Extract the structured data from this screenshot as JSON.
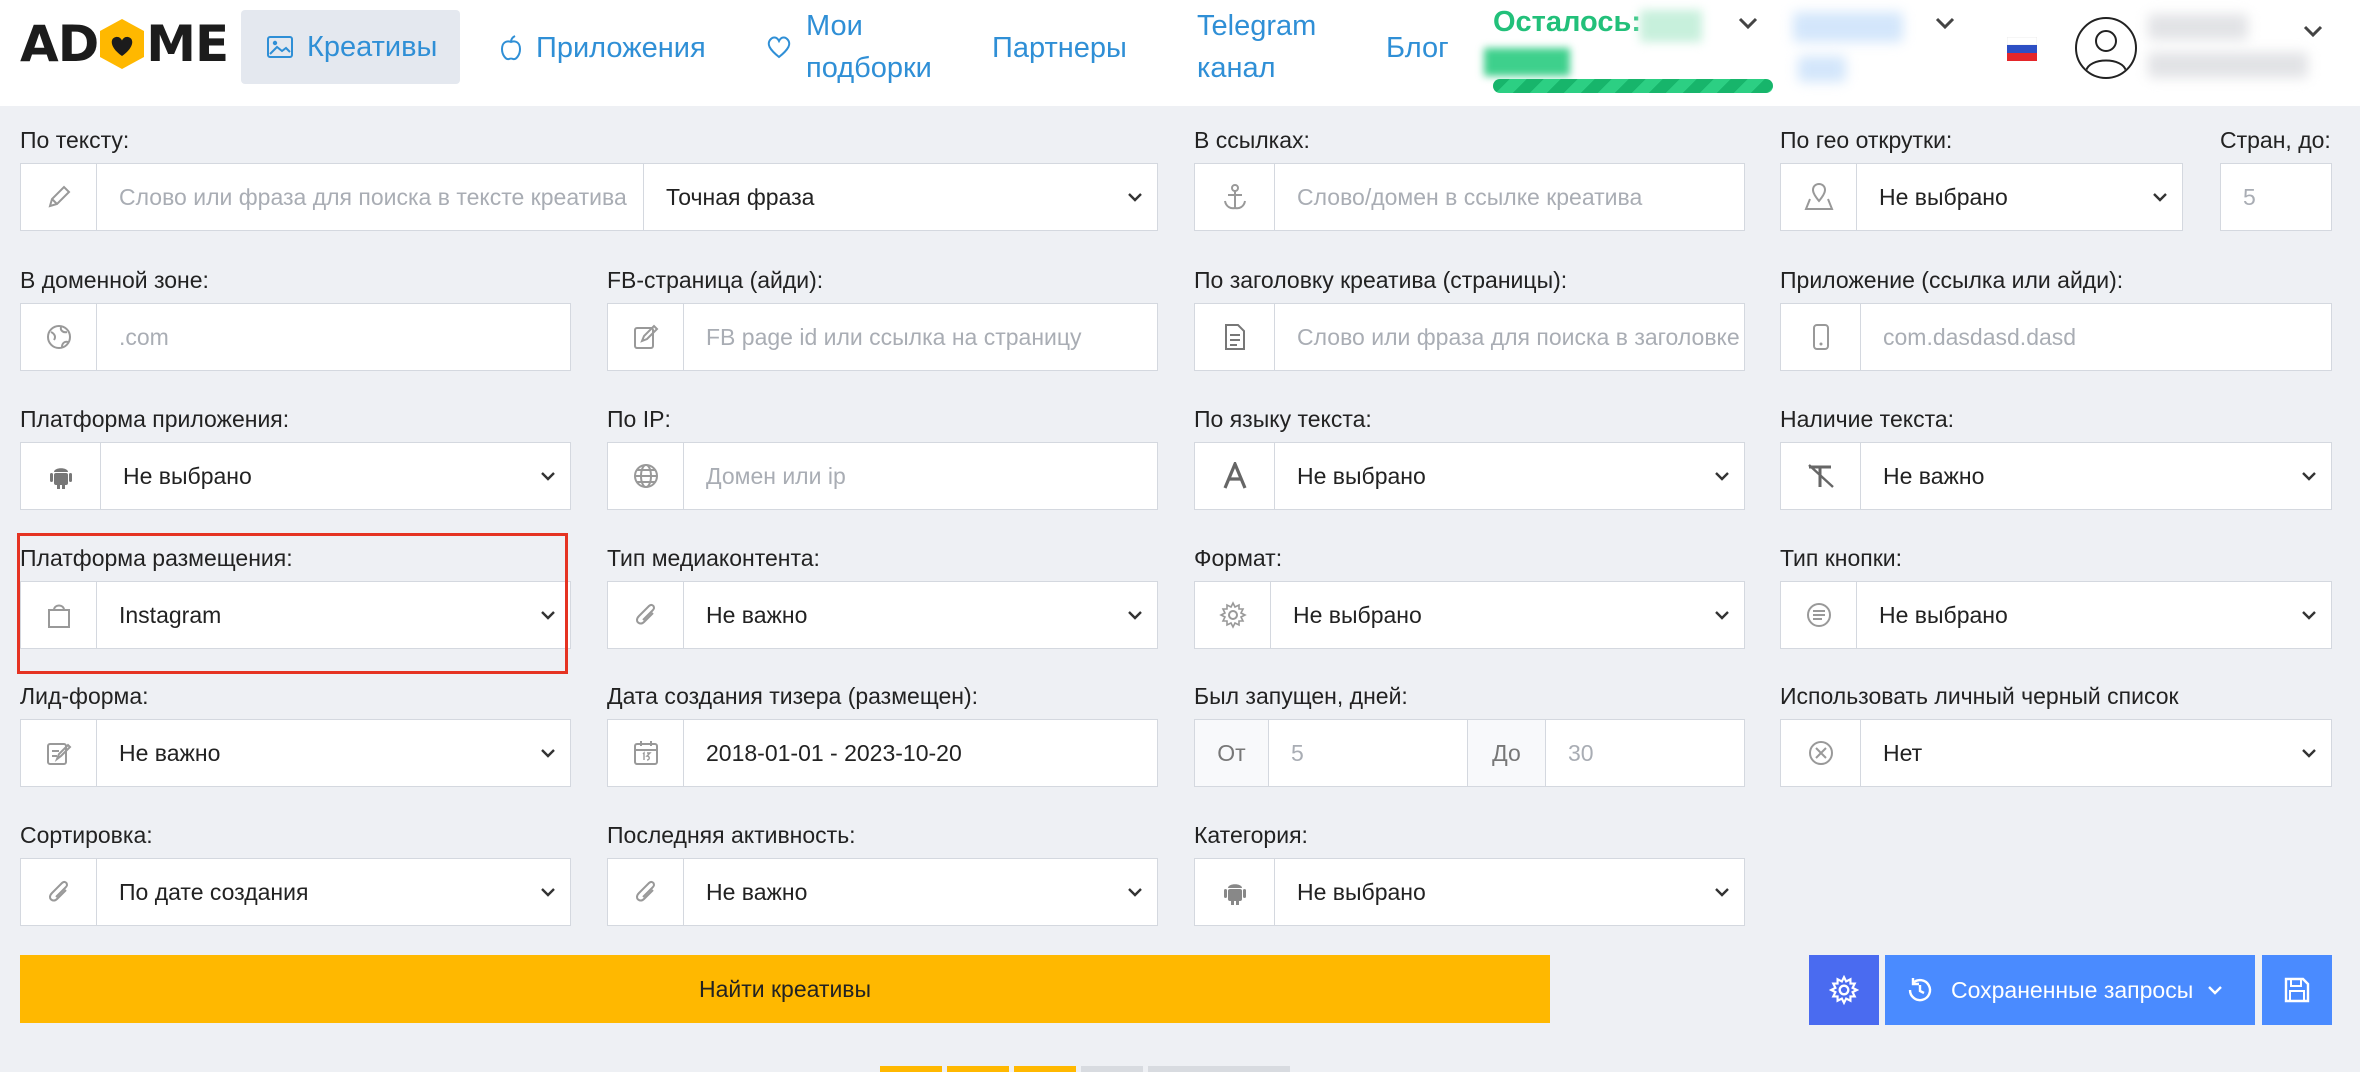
{
  "header": {
    "logo": {
      "left": "AD",
      "right": "ME"
    },
    "nav": [
      {
        "label": "Креативы",
        "icon": "image-icon",
        "active": true
      },
      {
        "label": "Приложения",
        "icon": "apple-icon"
      },
      {
        "label_line1": "Мои",
        "label_line2": "подборки",
        "icon": "heart-icon"
      },
      {
        "label": "Партнеры"
      },
      {
        "label_line1": "Telegram",
        "label_line2": "канал"
      },
      {
        "label": "Блог"
      }
    ],
    "remaining_label": "Осталось:",
    "flag": "russian-flag-icon"
  },
  "form": {
    "text_search": {
      "label": "По тексту:",
      "placeholder": "Слово или фраза для поиска в тексте креатива",
      "mode": "Точная фраза"
    },
    "links": {
      "label": "В ссылках:",
      "placeholder": "Слово/домен в ссылке креатива"
    },
    "geo": {
      "label": "По гео открутки:",
      "value": "Не выбрано"
    },
    "countries": {
      "label": "Стран, до:",
      "placeholder": "5"
    },
    "domain_zone": {
      "label": "В доменной зоне:",
      "placeholder": ".com"
    },
    "fb_page": {
      "label": "FB-страница (айди):",
      "placeholder": "FB page id или ссылка на страницу"
    },
    "headline": {
      "label": "По заголовку креатива (страницы):",
      "placeholder": "Слово или фраза для поиска в заголовке"
    },
    "app": {
      "label": "Приложение (ссылка или айди):",
      "placeholder": "com.dasdasd.dasd"
    },
    "app_platform": {
      "label": "Платформа приложения:",
      "value": "Не выбрано"
    },
    "ip": {
      "label": "По IP:",
      "placeholder": "Домен или  ip"
    },
    "text_lang": {
      "label": "По языку текста:",
      "value": "Не выбрано"
    },
    "has_text": {
      "label": "Наличие текста:",
      "value": "Не важно"
    },
    "placement": {
      "label": "Платформа размещения:",
      "value": "Instagram"
    },
    "media_type": {
      "label": "Тип медиаконтента:",
      "value": "Не важно"
    },
    "format": {
      "label": "Формат:",
      "value": "Не выбрано"
    },
    "button_type": {
      "label": "Тип кнопки:",
      "value": "Не выбрано"
    },
    "lead_form": {
      "label": "Лид-форма:",
      "value": "Не важно"
    },
    "created_date": {
      "label": "Дата создания тизера (размещен):",
      "value": "2018-01-01 - 2023-10-20"
    },
    "days_running": {
      "label": "Был запущен, дней:",
      "from_label": "От",
      "from_placeholder": "5",
      "to_label": "До",
      "to_placeholder": "30"
    },
    "blacklist": {
      "label": "Использовать личный черный список",
      "value": "Нет"
    },
    "sort": {
      "label": "Сортировка:",
      "value": "По дате создания"
    },
    "last_activity": {
      "label": "Последняя активность:",
      "value": "Не важно"
    },
    "category": {
      "label": "Категория:",
      "value": "Не выбрано"
    }
  },
  "actions": {
    "find_label": "Найти креативы",
    "saved_queries_label": "Сохраненные запросы"
  },
  "colors": {
    "accent_blue": "#2f8fd6",
    "find_button": "#ffb800",
    "remaining_green": "#22c07a",
    "highlight_red": "#e53322"
  }
}
